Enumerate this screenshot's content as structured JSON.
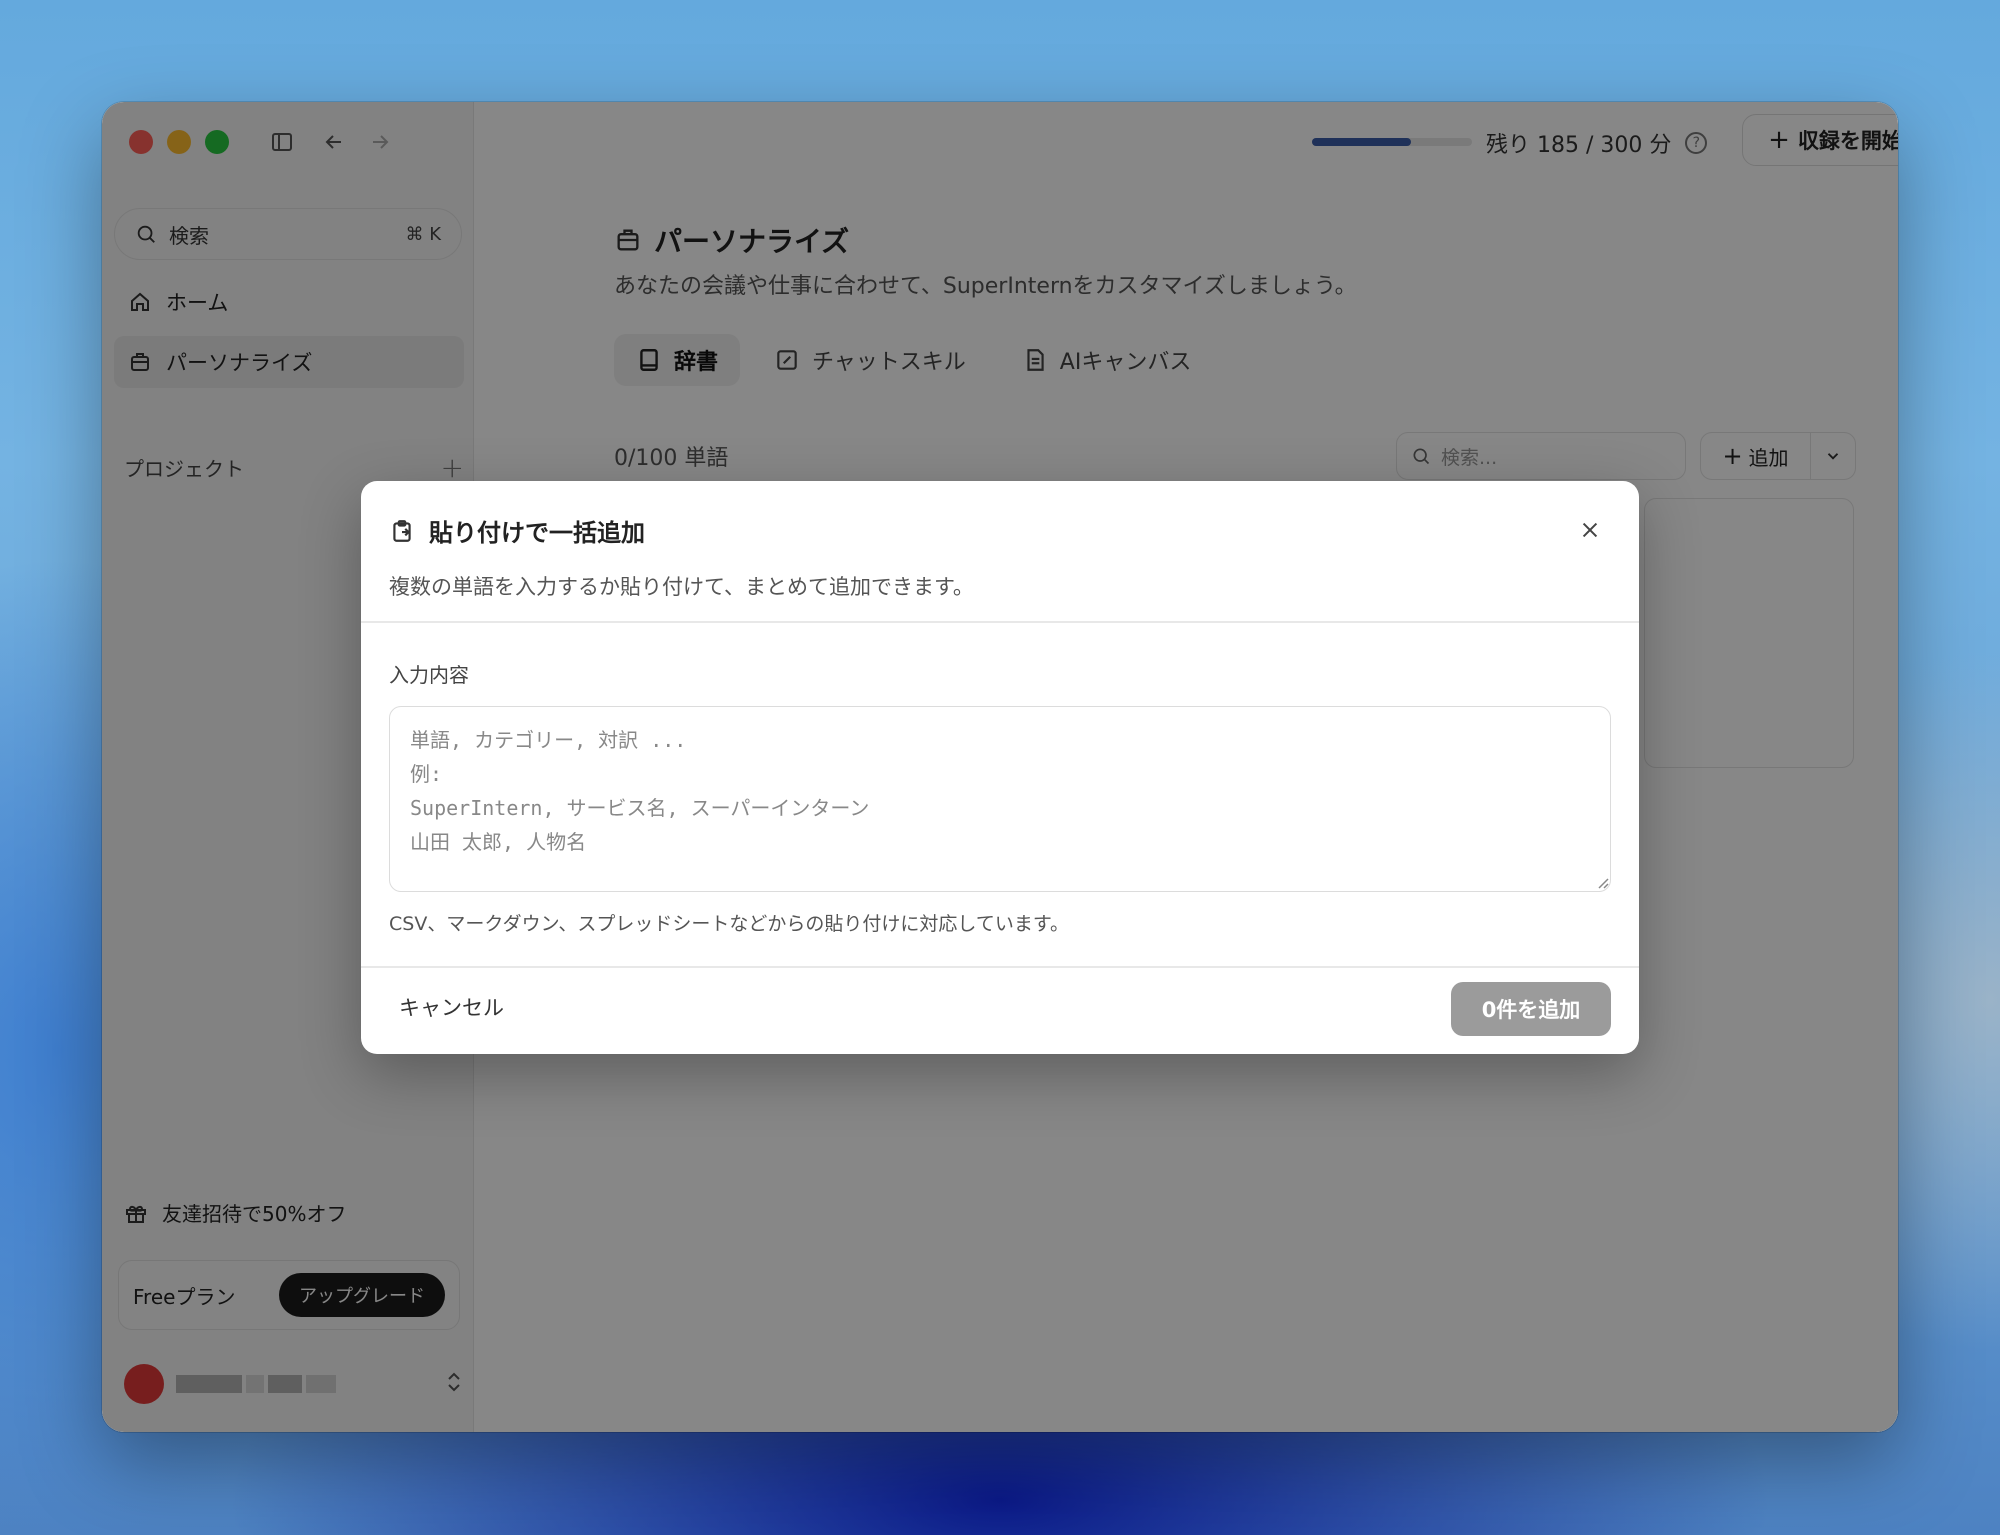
{
  "window": {
    "search": {
      "label": "検索",
      "shortcut": "⌘ K"
    },
    "nav": [
      {
        "label": "ホーム",
        "icon": "home-icon"
      },
      {
        "label": "パーソナライズ",
        "icon": "personalize-icon",
        "active": true
      }
    ],
    "projects_label": "プロジェクト",
    "invite_label": "友達招待で50%オフ",
    "plan": {
      "name": "Freeプラン",
      "upgrade": "アップグレード"
    },
    "user": {
      "avatar_color": "#e03a3a"
    }
  },
  "topbar": {
    "usage_fraction": 0.62,
    "remaining_text": "残り 185 / 300 分",
    "record_button": "収録を開始"
  },
  "page": {
    "title": "パーソナライズ",
    "subtitle": "あなたの会議や仕事に合わせて、SuperInternをカスタマイズしましょう。",
    "tabs": [
      {
        "label": "辞書",
        "active": true
      },
      {
        "label": "チャットスキル"
      },
      {
        "label": "AIキャンバス"
      }
    ],
    "word_count": "0/100 単語",
    "search_placeholder": "検索...",
    "add_button": "追加"
  },
  "dialog": {
    "title": "貼り付けで一括追加",
    "description": "複数の単語を入力するか貼り付けて、まとめて追加できます。",
    "field_label": "入力内容",
    "placeholder": "単語, カテゴリー, 対訳 ...\n例:\nSuperIntern, サービス名, スーパーインターン\n山田 太郎, 人物名",
    "hint": "CSV、マークダウン、スプレッドシートなどからの貼り付けに対応しています。",
    "cancel": "キャンセル",
    "submit": "0件を追加"
  }
}
